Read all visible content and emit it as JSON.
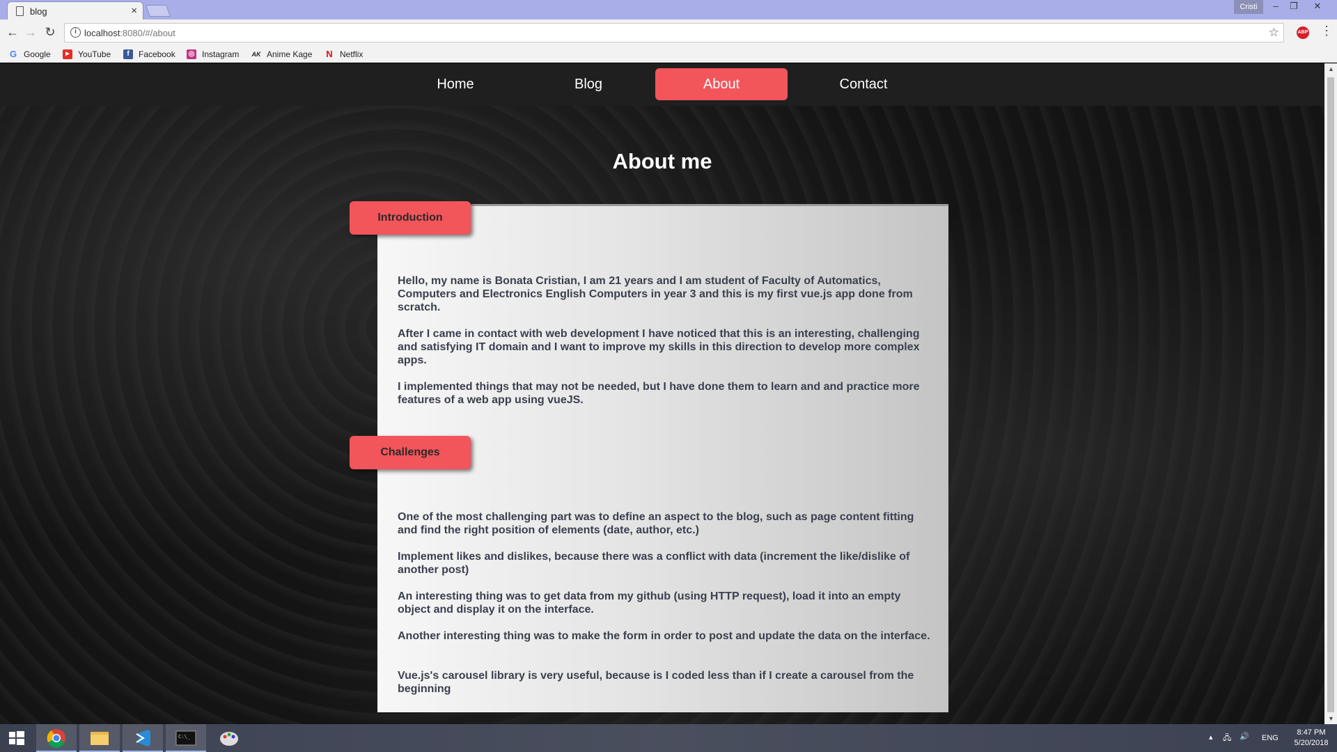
{
  "browser": {
    "tab_title": "blog",
    "tab_close": "×",
    "user": "Cristi",
    "url_host": "localhost",
    "url_path": ":8080/#/about",
    "bookmarks": [
      {
        "label": "Google",
        "icon": "google-icon",
        "color": "#4285f4",
        "glyph": "G"
      },
      {
        "label": "YouTube",
        "icon": "youtube-icon",
        "color": "#e52d27",
        "glyph": "▶"
      },
      {
        "label": "Facebook",
        "icon": "facebook-icon",
        "color": "#3b5998",
        "glyph": "f"
      },
      {
        "label": "Instagram",
        "icon": "instagram-icon",
        "color": "#c13584",
        "glyph": "◎"
      },
      {
        "label": "Anime Kage",
        "icon": "animekage-icon",
        "color": "#222222",
        "glyph": "AK"
      },
      {
        "label": "Netflix",
        "icon": "netflix-icon",
        "color": "#e50914",
        "glyph": "N"
      }
    ]
  },
  "site": {
    "nav": [
      "Home",
      "Blog",
      "About",
      "Contact"
    ],
    "active_nav": "About",
    "accent_color": "#f2555a",
    "page_title": "About me",
    "sections": [
      {
        "tag": "Introduction",
        "paragraphs": [
          "Hello, my name is Bonata Cristian, I am 21 years and I am student of Faculty of Automatics, Computers and Electronics English Computers in year 3 and this is my first vue.js app done from scratch.",
          "After I came in contact with web development I have noticed that this is an interesting, challenging and satisfying IT domain and I want to improve my skills in this direction to develop more complex apps.",
          "I implemented things that may not be needed, but I have done them to learn and and practice more features of a web app using vueJS."
        ]
      },
      {
        "tag": "Challenges",
        "paragraphs": [
          "One of the most challenging part was to define an aspect to the blog, such as page content fitting and find the right position of elements (date, author, etc.)",
          "Implement likes and dislikes, because there was a conflict with data (increment the like/dislike of another post)",
          "An interesting thing was to get data from my github (using HTTP request), load it into an empty object and display it on the interface.",
          "Another interesting thing was to make the form in order to post and update the data on the interface.",
          "Vue.js's carousel library is very useful, because is I coded less than if I create a carousel from the beginning"
        ]
      }
    ]
  },
  "taskbar": {
    "language": "ENG",
    "time": "8:47 PM",
    "date": "5/20/2018"
  }
}
